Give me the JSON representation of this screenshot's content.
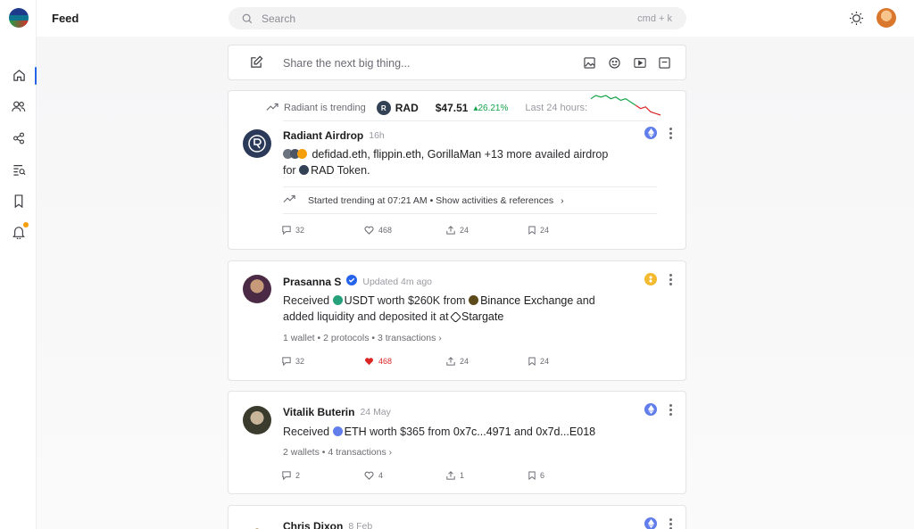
{
  "sidebar": {
    "items": [
      "home",
      "users",
      "network",
      "search-list",
      "bookmarks",
      "notifications"
    ]
  },
  "header": {
    "title": "Feed",
    "search_placeholder": "Search",
    "search_shortcut": "cmd + k"
  },
  "composer": {
    "placeholder": "Share the next big thing..."
  },
  "posts": [
    {
      "trending": {
        "label": "Radiant is trending",
        "token": "RAD",
        "price": "$47.51",
        "change": "26.21%",
        "window": "Last 24 hours:",
        "sparkline": [
          12,
          14,
          13,
          14,
          12,
          13,
          11,
          12,
          10,
          8,
          6,
          7,
          4,
          3,
          2
        ]
      },
      "author": "Radiant Airdrop",
      "time": "16h",
      "line1_accounts": "defidad.eth, flippin.eth, GorillaMan",
      "line1_rest": "+13 more availed airdrop",
      "line2_for": "for",
      "line2_token": "RAD",
      "line2_rest": "Token.",
      "trend_note": "Started trending at 07:21 AM • Show activities & references",
      "counts": {
        "comments": "32",
        "likes": "468",
        "shares": "24",
        "saves": "24"
      },
      "chain": "ethereum"
    },
    {
      "author": "Prasanna S",
      "time": "Updated 4m ago",
      "line1": "Received",
      "asset": "USDT",
      "amount_text": "worth $260K from",
      "source": "Binance Exchange",
      "tail": "and",
      "line2": "added liquidity and deposited it at",
      "dest": "Stargate",
      "meta": "1 wallet • 2 protocols • 3 transactions",
      "counts": {
        "comments": "32",
        "likes": "468",
        "shares": "24",
        "saves": "24"
      },
      "liked": true,
      "chain": "bnb"
    },
    {
      "author": "Vitalik Buterin",
      "time": "24 May",
      "line1": "Received",
      "asset": "ETH",
      "amount_text": "worth $365 from",
      "from": "0x7c...4971",
      "and": "and",
      "to": "0x7d...E018",
      "meta": "2 wallets • 4 transactions",
      "counts": {
        "comments": "2",
        "likes": "4",
        "shares": "1",
        "saves": "6"
      },
      "chain": "ethereum"
    },
    {
      "author": "Chris Dixon",
      "time": "8 Feb",
      "chain": "ethereum"
    }
  ],
  "colors": {
    "accent": "#2563eb",
    "up": "#16a34a",
    "down": "#dc2626",
    "like": "#dc2626",
    "eth": "#627eea",
    "bnb": "#f3ba2f"
  }
}
